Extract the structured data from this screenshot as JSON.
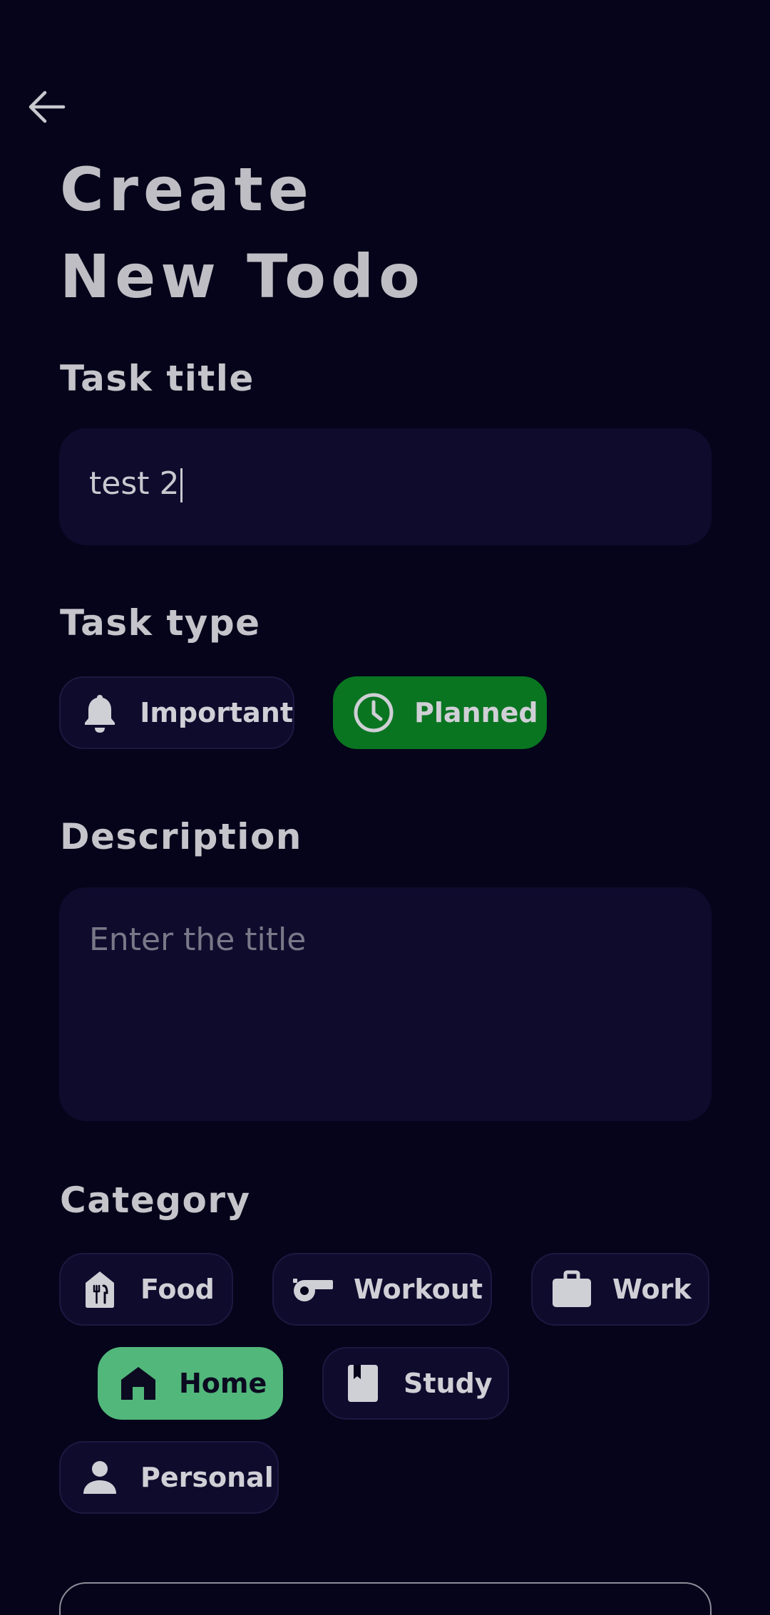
{
  "header": {
    "title_line1": "Create",
    "title_line2": "New Todo"
  },
  "task_title": {
    "label": "Task title",
    "value": "test 2"
  },
  "task_type": {
    "label": "Task type",
    "options": [
      {
        "label": "Important",
        "icon": "bell-icon",
        "selected": false
      },
      {
        "label": "Planned",
        "icon": "clock-icon",
        "selected": true
      }
    ]
  },
  "description": {
    "label": "Description",
    "value": "",
    "placeholder": "Enter the title"
  },
  "category": {
    "label": "Category",
    "options": [
      {
        "label": "Food",
        "icon": "food-icon",
        "selected": false
      },
      {
        "label": "Workout",
        "icon": "whistle-icon",
        "selected": false
      },
      {
        "label": "Work",
        "icon": "briefcase-icon",
        "selected": false
      },
      {
        "label": "Home",
        "icon": "home-icon",
        "selected": true
      },
      {
        "label": "Study",
        "icon": "book-icon",
        "selected": false
      },
      {
        "label": "Personal",
        "icon": "person-icon",
        "selected": false
      }
    ]
  },
  "colors": {
    "background": "#05041a",
    "field": "#0f0b2d",
    "selected_type": "#0a7521",
    "selected_category": "#52b77b"
  }
}
